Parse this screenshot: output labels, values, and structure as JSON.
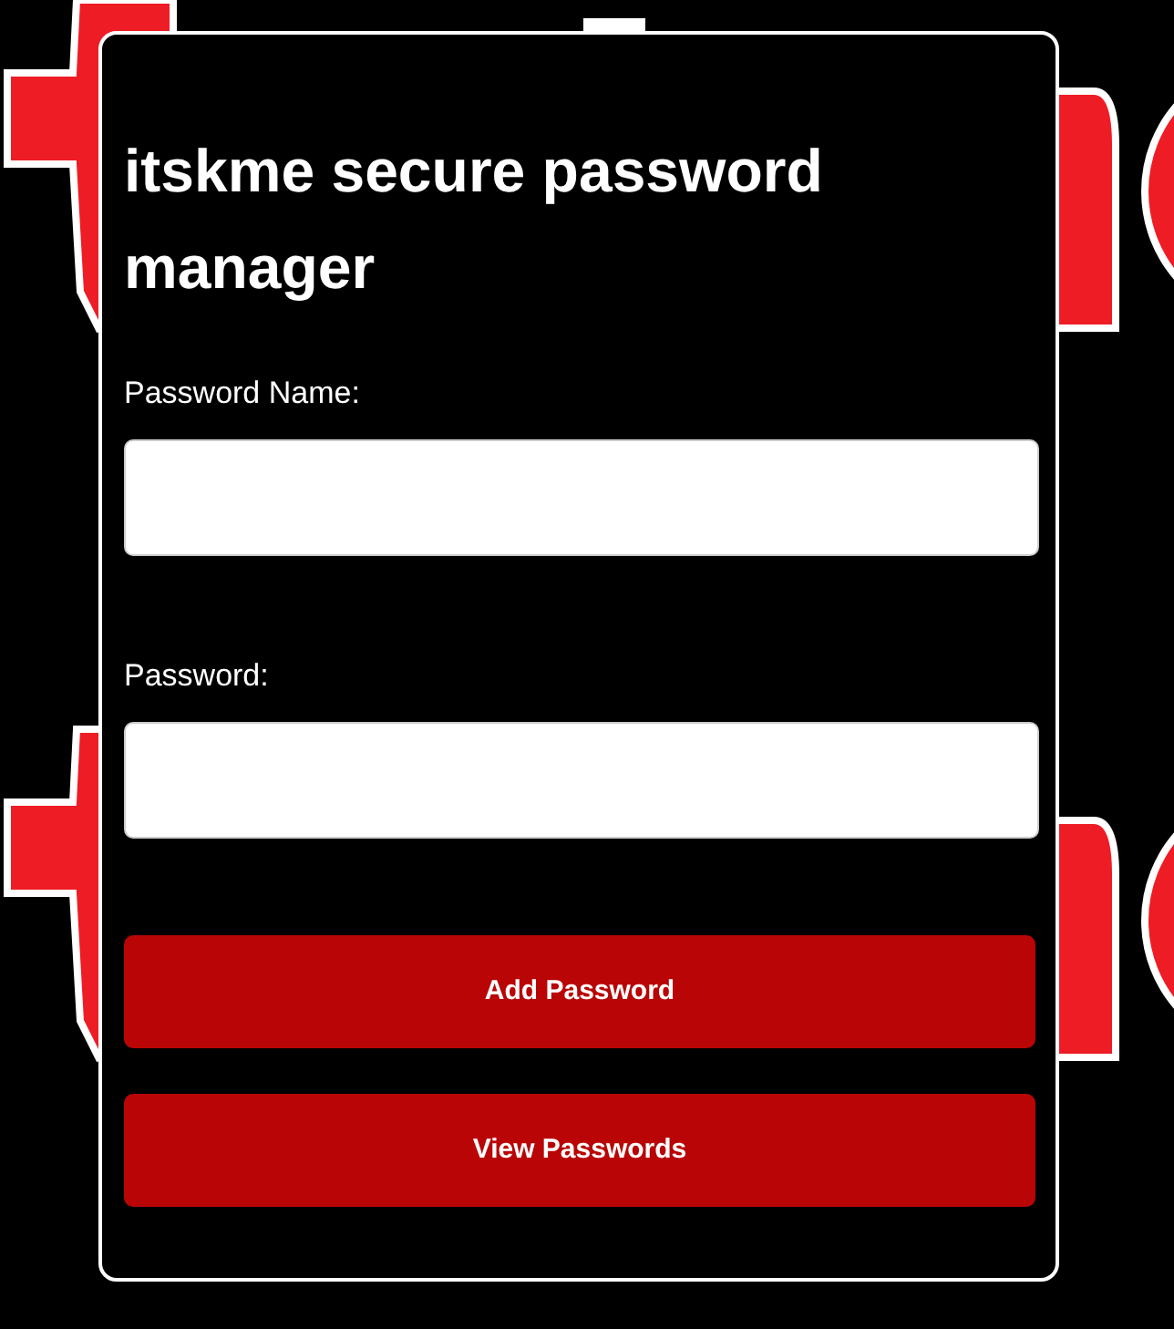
{
  "title": "itskme secure password manager",
  "fields": [
    {
      "label": "Password Name:"
    },
    {
      "label": "Password:"
    }
  ],
  "buttons": [
    "Add Password",
    "View Passwords"
  ]
}
